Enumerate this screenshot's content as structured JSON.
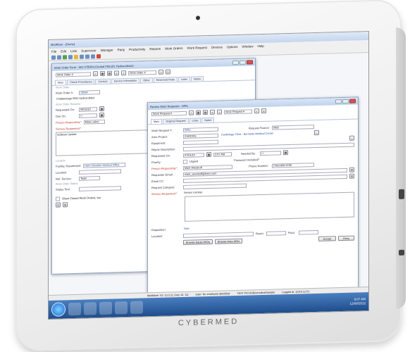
{
  "brand": "CYBERMED",
  "app": {
    "title": "MedMizer - [Demo]"
  },
  "menu": [
    "File",
    "Edit",
    "Lists",
    "Supervisor",
    "Manager",
    "Party",
    "Productivity",
    "Reports",
    "Work Orders",
    "Work Request",
    "Devices",
    "Options",
    "Window",
    "Help"
  ],
  "wo": {
    "title": "Work Order Form - WO #78084 (Central P5E101 Hydrocollator)",
    "search": "Work Order #",
    "tabs": [
      "Main",
      "Check Procedures",
      "Contact",
      "Service Information",
      "Other",
      "Reserved Parts",
      "Links",
      "Notes"
    ],
    "sec_work_order": "Work Order",
    "wo_label": "Work Order #:",
    "wo_value": "78084",
    "device": "Chattanooga 2502 Hydrocollator",
    "sec_request": "Work Order Request",
    "requested_on_label": "Requested On:",
    "requested_on": "09/15/10",
    "due_label": "Due On:",
    "due": "/ /",
    "person_label": "Person Requesting:*",
    "person": "Manu value",
    "service_label": "Service Requested:*",
    "service": "Softener Update",
    "sec_location": "Location",
    "facility_label": "Facility, Department:",
    "facility": "Herb Otonther Medical Office",
    "location_label": "Location:",
    "ref_label": "Ref. Service:",
    "ref_value": "Team",
    "sec_status": "Work Order Status",
    "status_label": "Status Text:",
    "show_closed": "Show Closed Work Orders, too"
  },
  "wr": {
    "title": "Review Work Requests - WR1",
    "search": "Work Request #",
    "nav": "Work Request #",
    "tabs": [
      "Main",
      "Original Request",
      "Links",
      "Notes"
    ],
    "fields": {
      "wr_label": "Work Request #:",
      "wr": "WR1",
      "source_label": "Request Source:",
      "source": "Web",
      "area_label": "Area Project:",
      "area": "CARDIOL",
      "area_desc": "Cardiology Clinic - Bernardo Medical Center",
      "equipment_label": "Equipment:",
      "repair_label": "Repair Description:",
      "requested_label": "Requested On:",
      "requested_date": "07/01/10",
      "requested_time": "2:07 PM",
      "needed_label": "Needed By:",
      "needed": "/ /",
      "priority_label": "Priority:",
      "priority": "Urgent",
      "password_label": "Password Included?",
      "person_label": "Person Requesting:*",
      "person": "Mark Woodruff",
      "phone_label": "Phone Number:",
      "phone": "(760) 809-9769",
      "email_label": "Requester Email:",
      "email": "mark_woodruff@bmcr.com",
      "emailcc_label": "Email CC:",
      "category_label": "Request Category:",
      "service_label": "Service Requested:*",
      "service": "Sensor Unclear",
      "disposition_label": "Disposition:",
      "disposition": "New",
      "location_label": "Location:",
      "room_label": "Room:",
      "floor_label": "Floor:",
      "browse_equip": "Browse Equip./WOs",
      "browse_area": "Browse Area WOs",
      "accept": "Accept",
      "deny": "Deny"
    }
  },
  "statusbar": {
    "version": "MedMizer V3: 13.3.11 (July 12, 11)",
    "user": "User: No employee identified",
    "db": "TEST PCVG\\BiomedicalSample",
    "logged": "Logged at: 12/19 12:51"
  },
  "clock": {
    "time": "9:07 AM",
    "date": "12/08/2012"
  },
  "colors": {
    "accent": "#1e4d8c",
    "required": "#c0392b",
    "link": "#2a4fa0"
  }
}
